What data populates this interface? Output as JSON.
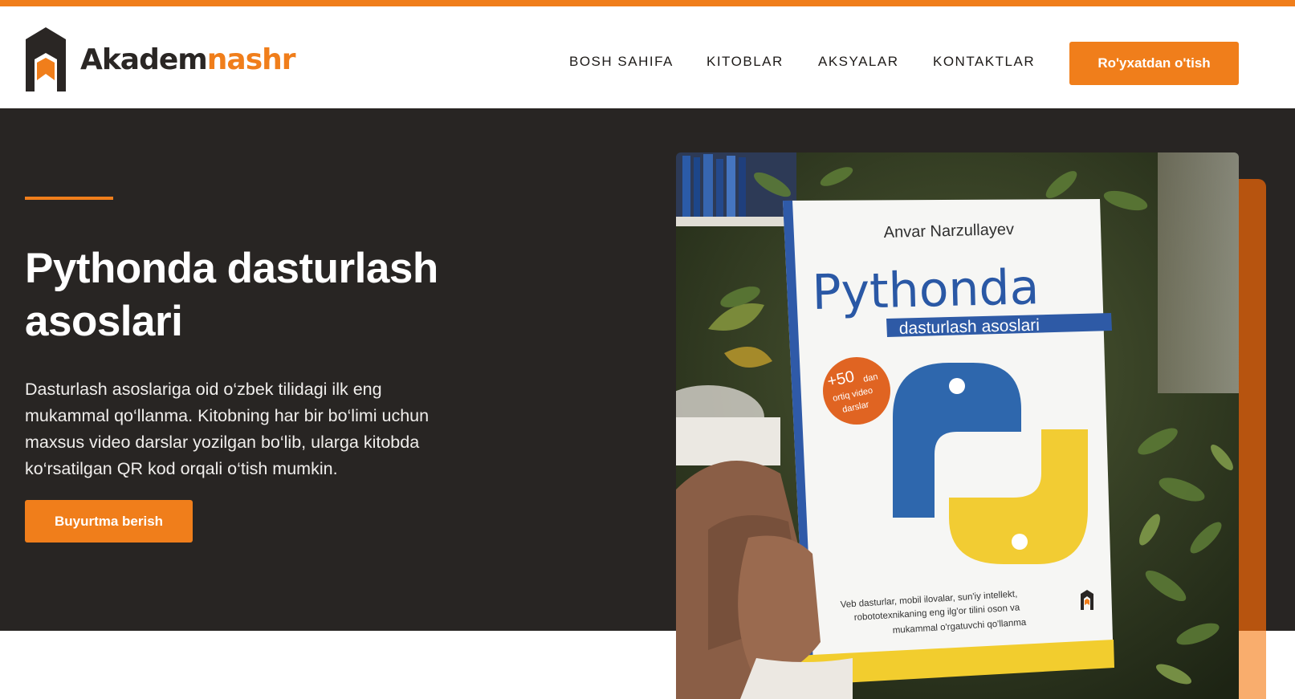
{
  "brand": {
    "name_part1": "Akadem",
    "name_part2": "nashr",
    "accent_color": "#f07e1b",
    "dark_color": "#282523"
  },
  "nav": {
    "items": [
      "BOSH SAHIFA",
      "KITOBLAR",
      "AKSYALAR",
      "KONTAKTLAR"
    ]
  },
  "header": {
    "register_label": "Ro'yxatdan o'tish"
  },
  "hero": {
    "title": "Pythonda dasturlash asoslari",
    "description": "Dasturlash asoslariga oid o‘zbek tilidagi ilk eng mukammal qo‘llanma. Kitobning har bir bo‘limi uchun maxsus video darslar yozilgan bo‘lib, ularga kitobda ko‘rsatilgan QR kod orqali o‘tish mumkin.",
    "order_label": "Buyurtma berish"
  },
  "book_cover": {
    "author": "Anvar Narzullayev",
    "title": "Pythonda",
    "subtitle": "dasturlash asoslari",
    "badge_line1": "+50",
    "badge_line2": "dan",
    "badge_line3": "ortiq video",
    "badge_line4": "darslar",
    "tagline_line1": "Veb dasturlar, mobil ilovalar, sun'iy intellekt,",
    "tagline_line2": "robototexnikaning eng ilg'or tilini oson va",
    "tagline_line3": "mukammal o'rgatuvchi qo'llanma"
  }
}
